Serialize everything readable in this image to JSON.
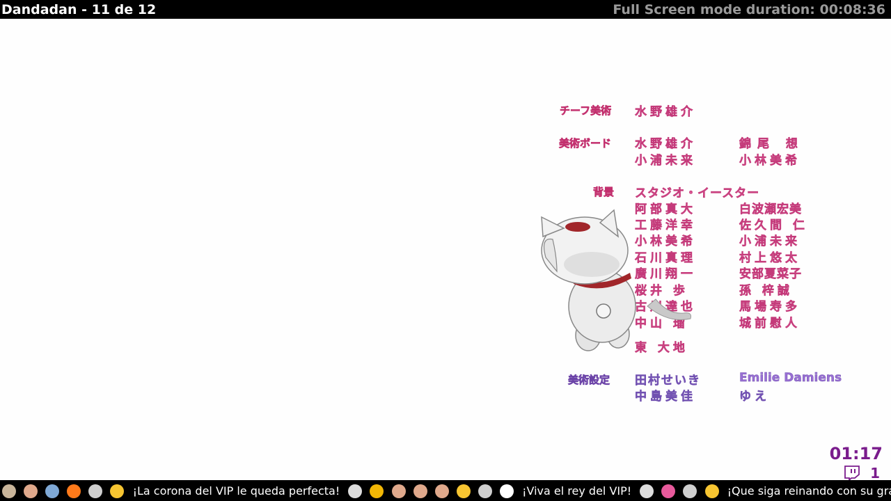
{
  "header": {
    "title": "Dandadan - 11 de 12",
    "duration": "Full Screen mode duration: 00:08:36"
  },
  "credits": {
    "chief_art_role": "チーフ美術",
    "chief_art_name": "水野雄介",
    "art_board_role": "美術ボード",
    "art_board_names": [
      "水野雄介",
      "錦尾 想",
      "小浦未来",
      "小林美希"
    ],
    "background_role": "背景",
    "background_studio": "スタジオ・イースター",
    "background_names_left": [
      "阿部真大",
      "工藤洋幸",
      "小林美希",
      "石川真理",
      "廣川翔一",
      "桜井 歩",
      "古川達也",
      "中山 瑠",
      "東 大地"
    ],
    "background_names_right": [
      "白波瀬宏美",
      "佐久間 仁",
      "小浦未来",
      "村上悠太",
      "安部夏菜子",
      "孫 梓誠",
      "馬場寿多",
      "城前慰人"
    ],
    "art_setting_role": "美術設定",
    "art_setting_names": [
      "田村せいき",
      "中島美佳",
      "Emilie Damiens",
      "ゆえ"
    ]
  },
  "overlay": {
    "timer": "01:17",
    "viewers": "1"
  },
  "ticker": {
    "messages": [
      "¡La corona del VIP le queda perfecta!",
      "¡Viva el rey del VIP!",
      "¡Que siga reinando con su grandeza!"
    ]
  },
  "colors": {
    "credit_pink": "#ea6aa4",
    "credit_purple": "#9a70d4",
    "overlay_purple": "#7a1c8c"
  }
}
